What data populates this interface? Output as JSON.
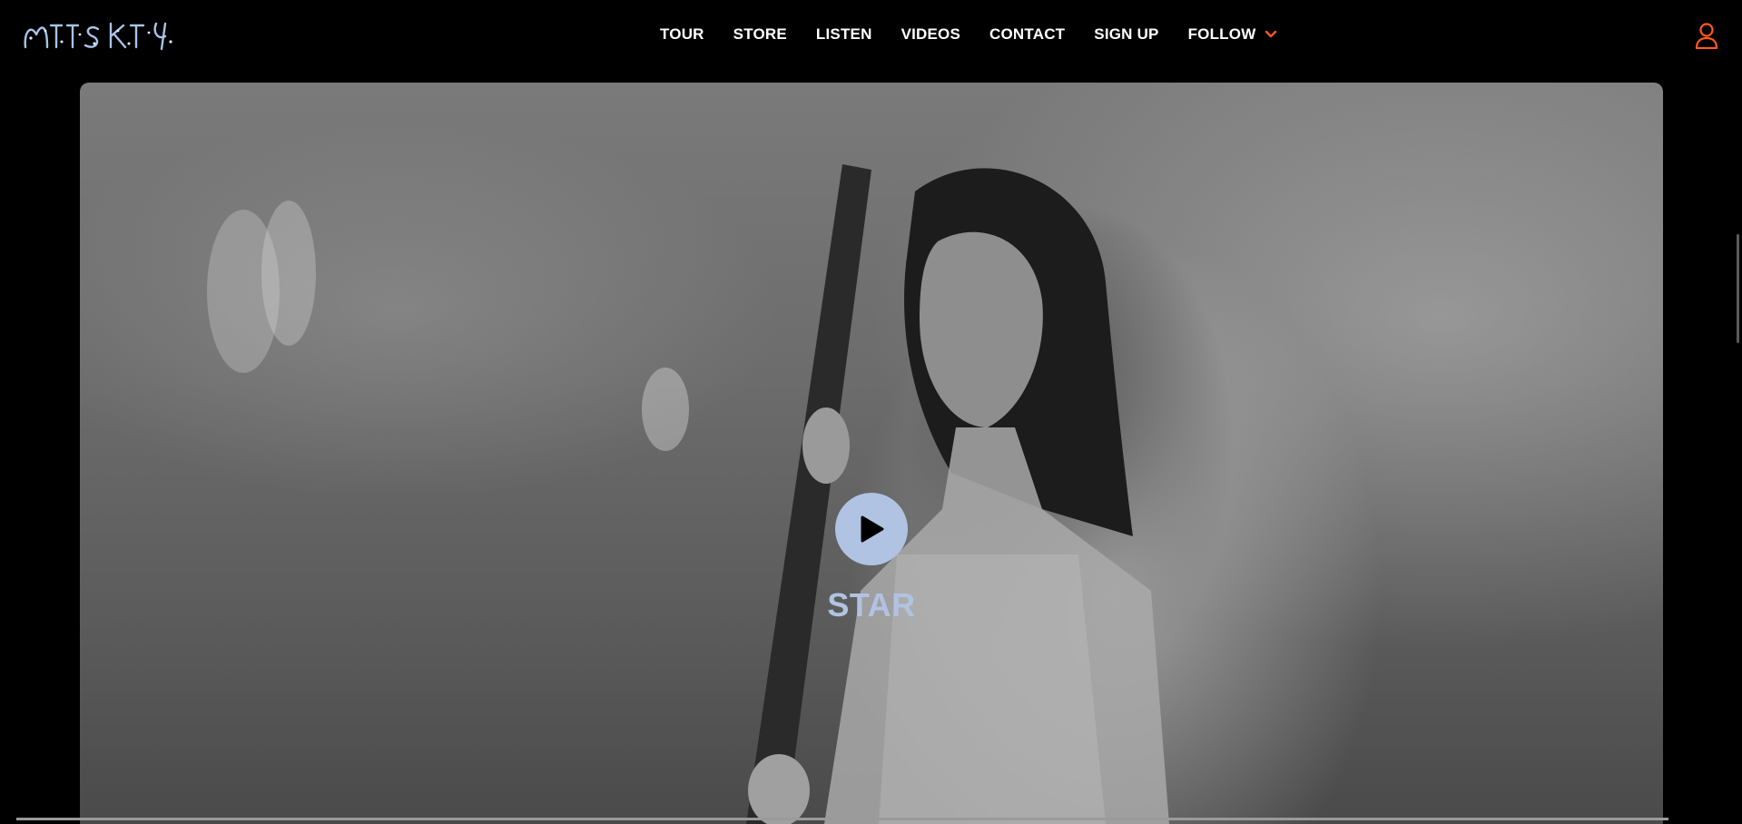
{
  "header": {
    "logo_text": "MITSKI",
    "nav": [
      {
        "label": "TOUR"
      },
      {
        "label": "STORE"
      },
      {
        "label": "LISTEN"
      },
      {
        "label": "VIDEOS"
      },
      {
        "label": "CONTACT"
      },
      {
        "label": "SIGN UP"
      },
      {
        "label": "FOLLOW"
      }
    ],
    "account_icon": "user-icon",
    "follow_icon": "chevron-down-icon"
  },
  "hero": {
    "video_title": "STAR",
    "play_icon": "play-icon"
  },
  "colors": {
    "accent": "#ff5a1f",
    "play_button": "#b1c3e3",
    "background": "#000000"
  }
}
